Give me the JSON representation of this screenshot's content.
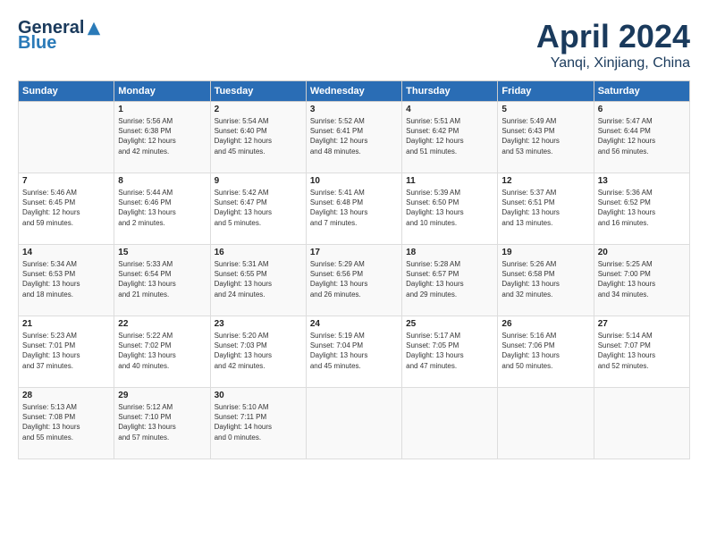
{
  "header": {
    "logo_general": "General",
    "logo_blue": "Blue",
    "month": "April 2024",
    "location": "Yanqi, Xinjiang, China"
  },
  "weekdays": [
    "Sunday",
    "Monday",
    "Tuesday",
    "Wednesday",
    "Thursday",
    "Friday",
    "Saturday"
  ],
  "weeks": [
    [
      {
        "day": "",
        "content": ""
      },
      {
        "day": "1",
        "content": "Sunrise: 5:56 AM\nSunset: 6:38 PM\nDaylight: 12 hours\nand 42 minutes."
      },
      {
        "day": "2",
        "content": "Sunrise: 5:54 AM\nSunset: 6:40 PM\nDaylight: 12 hours\nand 45 minutes."
      },
      {
        "day": "3",
        "content": "Sunrise: 5:52 AM\nSunset: 6:41 PM\nDaylight: 12 hours\nand 48 minutes."
      },
      {
        "day": "4",
        "content": "Sunrise: 5:51 AM\nSunset: 6:42 PM\nDaylight: 12 hours\nand 51 minutes."
      },
      {
        "day": "5",
        "content": "Sunrise: 5:49 AM\nSunset: 6:43 PM\nDaylight: 12 hours\nand 53 minutes."
      },
      {
        "day": "6",
        "content": "Sunrise: 5:47 AM\nSunset: 6:44 PM\nDaylight: 12 hours\nand 56 minutes."
      }
    ],
    [
      {
        "day": "7",
        "content": "Sunrise: 5:46 AM\nSunset: 6:45 PM\nDaylight: 12 hours\nand 59 minutes."
      },
      {
        "day": "8",
        "content": "Sunrise: 5:44 AM\nSunset: 6:46 PM\nDaylight: 13 hours\nand 2 minutes."
      },
      {
        "day": "9",
        "content": "Sunrise: 5:42 AM\nSunset: 6:47 PM\nDaylight: 13 hours\nand 5 minutes."
      },
      {
        "day": "10",
        "content": "Sunrise: 5:41 AM\nSunset: 6:48 PM\nDaylight: 13 hours\nand 7 minutes."
      },
      {
        "day": "11",
        "content": "Sunrise: 5:39 AM\nSunset: 6:50 PM\nDaylight: 13 hours\nand 10 minutes."
      },
      {
        "day": "12",
        "content": "Sunrise: 5:37 AM\nSunset: 6:51 PM\nDaylight: 13 hours\nand 13 minutes."
      },
      {
        "day": "13",
        "content": "Sunrise: 5:36 AM\nSunset: 6:52 PM\nDaylight: 13 hours\nand 16 minutes."
      }
    ],
    [
      {
        "day": "14",
        "content": "Sunrise: 5:34 AM\nSunset: 6:53 PM\nDaylight: 13 hours\nand 18 minutes."
      },
      {
        "day": "15",
        "content": "Sunrise: 5:33 AM\nSunset: 6:54 PM\nDaylight: 13 hours\nand 21 minutes."
      },
      {
        "day": "16",
        "content": "Sunrise: 5:31 AM\nSunset: 6:55 PM\nDaylight: 13 hours\nand 24 minutes."
      },
      {
        "day": "17",
        "content": "Sunrise: 5:29 AM\nSunset: 6:56 PM\nDaylight: 13 hours\nand 26 minutes."
      },
      {
        "day": "18",
        "content": "Sunrise: 5:28 AM\nSunset: 6:57 PM\nDaylight: 13 hours\nand 29 minutes."
      },
      {
        "day": "19",
        "content": "Sunrise: 5:26 AM\nSunset: 6:58 PM\nDaylight: 13 hours\nand 32 minutes."
      },
      {
        "day": "20",
        "content": "Sunrise: 5:25 AM\nSunset: 7:00 PM\nDaylight: 13 hours\nand 34 minutes."
      }
    ],
    [
      {
        "day": "21",
        "content": "Sunrise: 5:23 AM\nSunset: 7:01 PM\nDaylight: 13 hours\nand 37 minutes."
      },
      {
        "day": "22",
        "content": "Sunrise: 5:22 AM\nSunset: 7:02 PM\nDaylight: 13 hours\nand 40 minutes."
      },
      {
        "day": "23",
        "content": "Sunrise: 5:20 AM\nSunset: 7:03 PM\nDaylight: 13 hours\nand 42 minutes."
      },
      {
        "day": "24",
        "content": "Sunrise: 5:19 AM\nSunset: 7:04 PM\nDaylight: 13 hours\nand 45 minutes."
      },
      {
        "day": "25",
        "content": "Sunrise: 5:17 AM\nSunset: 7:05 PM\nDaylight: 13 hours\nand 47 minutes."
      },
      {
        "day": "26",
        "content": "Sunrise: 5:16 AM\nSunset: 7:06 PM\nDaylight: 13 hours\nand 50 minutes."
      },
      {
        "day": "27",
        "content": "Sunrise: 5:14 AM\nSunset: 7:07 PM\nDaylight: 13 hours\nand 52 minutes."
      }
    ],
    [
      {
        "day": "28",
        "content": "Sunrise: 5:13 AM\nSunset: 7:08 PM\nDaylight: 13 hours\nand 55 minutes."
      },
      {
        "day": "29",
        "content": "Sunrise: 5:12 AM\nSunset: 7:10 PM\nDaylight: 13 hours\nand 57 minutes."
      },
      {
        "day": "30",
        "content": "Sunrise: 5:10 AM\nSunset: 7:11 PM\nDaylight: 14 hours\nand 0 minutes."
      },
      {
        "day": "",
        "content": ""
      },
      {
        "day": "",
        "content": ""
      },
      {
        "day": "",
        "content": ""
      },
      {
        "day": "",
        "content": ""
      }
    ]
  ]
}
